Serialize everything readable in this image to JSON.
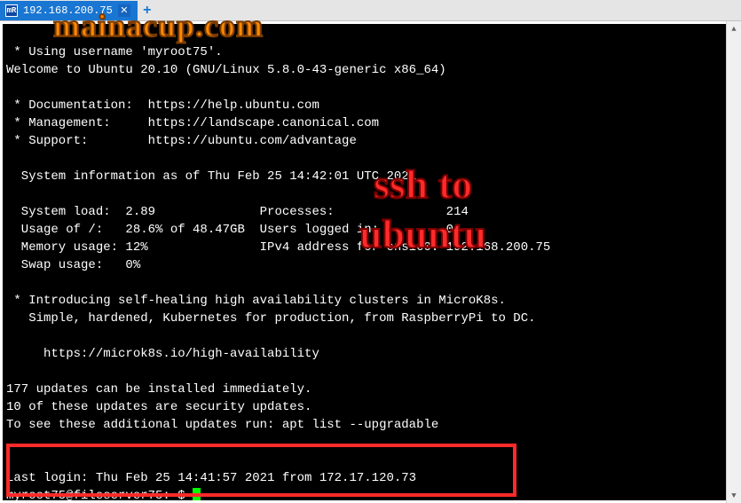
{
  "tab": {
    "icon_letters": "mR",
    "label": "192.168.200.75",
    "close_glyph": "✕",
    "add_glyph": "+"
  },
  "terminal": {
    "lines": [
      " * Using username 'myroot75'.",
      "Welcome to Ubuntu 20.10 (GNU/Linux 5.8.0-43-generic x86_64)",
      "",
      " * Documentation:  https://help.ubuntu.com",
      " * Management:     https://landscape.canonical.com",
      " * Support:        https://ubuntu.com/advantage",
      "",
      "  System information as of Thu Feb 25 14:42:01 UTC 2021",
      "",
      "  System load:  2.89              Processes:               214",
      "  Usage of /:   28.6% of 48.47GB  Users logged in:         0",
      "  Memory usage: 12%               IPv4 address for ens160: 192.168.200.75",
      "  Swap usage:   0%",
      "",
      " * Introducing self-healing high availability clusters in MicroK8s.",
      "   Simple, hardened, Kubernetes for production, from RaspberryPi to DC.",
      "",
      "     https://microk8s.io/high-availability",
      "",
      "177 updates can be installed immediately.",
      "10 of these updates are security updates.",
      "To see these additional updates run: apt list --upgradable",
      "",
      "",
      "Last login: Thu Feb 25 14:41:57 2021 from 172.17.120.73"
    ],
    "prompt": "myroot75@fileserver75:~$ "
  },
  "overlay": {
    "watermark": "mainacup.com",
    "banner_line1": "ssh to",
    "banner_line2": "ubuntu"
  },
  "scroll": {
    "up_glyph": "▲",
    "down_glyph": "▼"
  }
}
